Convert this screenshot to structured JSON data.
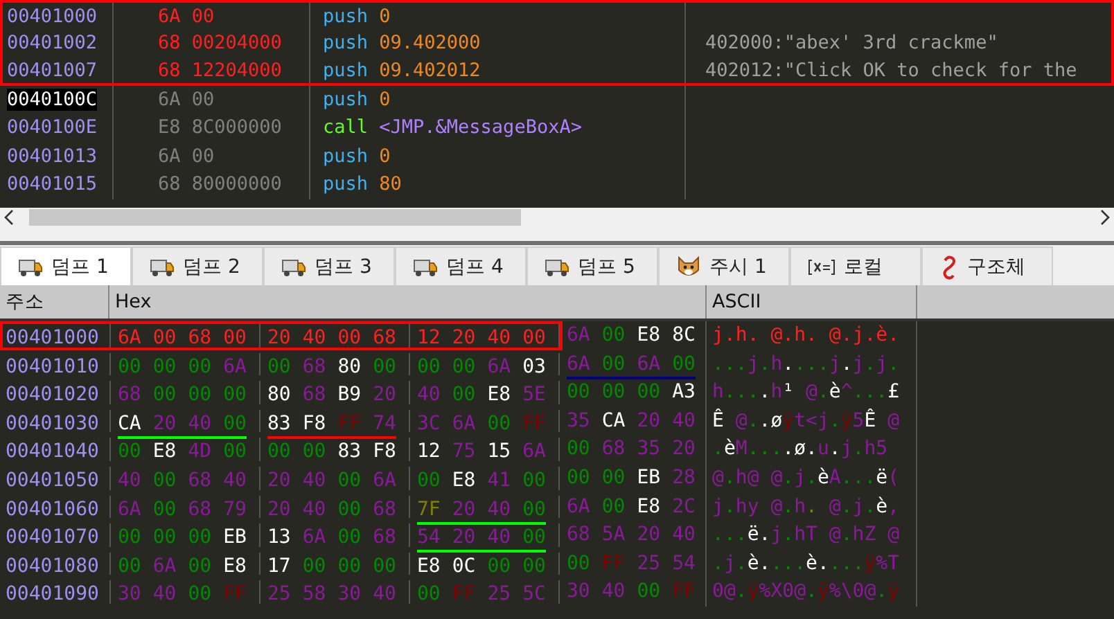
{
  "disassembly": {
    "rows": [
      {
        "address": "00401000",
        "bytes": "6A 00",
        "mnemonic": "push",
        "kind": "push",
        "operand": "0",
        "selected": true,
        "current": false
      },
      {
        "address": "00401002",
        "bytes": "68 00204000",
        "mnemonic": "push",
        "kind": "push",
        "operand": "09.402000",
        "comment": "402000:\"abex' 3rd crackme\"",
        "selected": true,
        "current": false
      },
      {
        "address": "00401007",
        "bytes": "68 12204000",
        "mnemonic": "push",
        "kind": "push",
        "operand": "09.402012",
        "comment": "402012:\"Click OK to check for the",
        "selected": true,
        "current": false
      },
      {
        "address": "0040100C",
        "bytes": "6A 00",
        "mnemonic": "push",
        "kind": "push",
        "operand": "0",
        "selected": false,
        "current": true
      },
      {
        "address": "0040100E",
        "bytes": "E8 8C000000",
        "mnemonic": "call",
        "kind": "call",
        "operand": "<JMP.&MessageBoxA>",
        "selected": false,
        "current": false
      },
      {
        "address": "00401013",
        "bytes": "6A 00",
        "mnemonic": "push",
        "kind": "push",
        "operand": "0",
        "selected": false,
        "current": false
      },
      {
        "address": "00401015",
        "bytes": "68 80000000",
        "mnemonic": "push",
        "kind": "push",
        "operand": "80",
        "selected": false,
        "current": false
      }
    ]
  },
  "tabs": [
    {
      "label": "덤프 1",
      "kind": "dump",
      "selected": true
    },
    {
      "label": "덤프 2",
      "kind": "dump",
      "selected": false
    },
    {
      "label": "덤프 3",
      "kind": "dump",
      "selected": false
    },
    {
      "label": "덤프 4",
      "kind": "dump",
      "selected": false
    },
    {
      "label": "덤프 5",
      "kind": "dump",
      "selected": false
    },
    {
      "label": "주시 1",
      "kind": "watch",
      "selected": false
    },
    {
      "label": "로컬",
      "kind": "locals",
      "selected": false
    },
    {
      "label": "구조체",
      "kind": "struct",
      "selected": false
    }
  ],
  "dump": {
    "columns": [
      "주소",
      "Hex",
      "ASCII"
    ],
    "rows": [
      {
        "address": "00401000",
        "selected": true,
        "groups": [
          {
            "bytes": [
              "6A",
              "00",
              "68",
              "00"
            ]
          },
          {
            "bytes": [
              "20",
              "40",
              "00",
              "68"
            ]
          },
          {
            "bytes": [
              "12",
              "20",
              "40",
              "00"
            ]
          },
          {
            "bytes": [
              "6A",
              "00",
              "E8",
              "8C"
            ]
          }
        ],
        "ascii": "j.h. @.h. @.j.è."
      },
      {
        "address": "00401010",
        "selected": false,
        "groups": [
          {
            "bytes": [
              "00",
              "00",
              "00",
              "6A"
            ]
          },
          {
            "bytes": [
              "00",
              "68",
              "80",
              "00"
            ]
          },
          {
            "bytes": [
              "00",
              "00",
              "6A",
              "03"
            ]
          },
          {
            "bytes": [
              "6A",
              "00",
              "6A",
              "00"
            ],
            "color": "#000080"
          }
        ],
        "ascii": "...j.h....j.j.j."
      },
      {
        "address": "00401020",
        "selected": false,
        "groups": [
          {
            "bytes": [
              "68",
              "00",
              "00",
              "00"
            ]
          },
          {
            "bytes": [
              "80",
              "68",
              "B9",
              "20"
            ]
          },
          {
            "bytes": [
              "40",
              "00",
              "E8",
              "5E"
            ]
          },
          {
            "bytes": [
              "00",
              "00",
              "00",
              "A3"
            ]
          }
        ],
        "ascii": "h....h¹ @.è^...£"
      },
      {
        "address": "00401030",
        "selected": false,
        "groups": [
          {
            "bytes": [
              "CA",
              "20",
              "40",
              "00"
            ],
            "color": "#00ff00"
          },
          {
            "bytes": [
              "83",
              "F8",
              "FF",
              "74"
            ],
            "color": "#ff0000"
          },
          {
            "bytes": [
              "3C",
              "6A",
              "00",
              "FF"
            ]
          },
          {
            "bytes": [
              "35",
              "CA",
              "20",
              "40"
            ]
          }
        ],
        "ascii": "Ê @..øÿt<j.ÿ5Ê @"
      },
      {
        "address": "00401040",
        "selected": false,
        "groups": [
          {
            "bytes": [
              "00",
              "E8",
              "4D",
              "00"
            ]
          },
          {
            "bytes": [
              "00",
              "00",
              "83",
              "F8"
            ]
          },
          {
            "bytes": [
              "12",
              "75",
              "15",
              "6A"
            ]
          },
          {
            "bytes": [
              "00",
              "68",
              "35",
              "20"
            ]
          }
        ],
        "ascii": ".èM....ø.u.j.h5 "
      },
      {
        "address": "00401050",
        "selected": false,
        "groups": [
          {
            "bytes": [
              "40",
              "00",
              "68",
              "40"
            ]
          },
          {
            "bytes": [
              "20",
              "40",
              "00",
              "6A"
            ]
          },
          {
            "bytes": [
              "00",
              "E8",
              "41",
              "00"
            ]
          },
          {
            "bytes": [
              "00",
              "00",
              "EB",
              "28"
            ]
          }
        ],
        "ascii": "@.h@ @.j.èA...ë("
      },
      {
        "address": "00401060",
        "selected": false,
        "groups": [
          {
            "bytes": [
              "6A",
              "00",
              "68",
              "79"
            ]
          },
          {
            "bytes": [
              "20",
              "40",
              "00",
              "68"
            ]
          },
          {
            "bytes": [
              "7F",
              "20",
              "40",
              "00"
            ],
            "color": "#00ff00"
          },
          {
            "bytes": [
              "6A",
              "00",
              "E8",
              "2C"
            ]
          }
        ],
        "ascii": "j.hy @.h. @.j.è,"
      },
      {
        "address": "00401070",
        "selected": false,
        "groups": [
          {
            "bytes": [
              "00",
              "00",
              "00",
              "EB"
            ]
          },
          {
            "bytes": [
              "13",
              "6A",
              "00",
              "68"
            ]
          },
          {
            "bytes": [
              "54",
              "20",
              "40",
              "00"
            ],
            "color": "#00ff00"
          },
          {
            "bytes": [
              "68",
              "5A",
              "20",
              "40"
            ]
          }
        ],
        "ascii": "...ë.j.hT @.hZ @"
      },
      {
        "address": "00401080",
        "selected": false,
        "groups": [
          {
            "bytes": [
              "00",
              "6A",
              "00",
              "E8"
            ]
          },
          {
            "bytes": [
              "17",
              "00",
              "00",
              "00"
            ]
          },
          {
            "bytes": [
              "E8",
              "0C",
              "00",
              "00"
            ]
          },
          {
            "bytes": [
              "00",
              "FF",
              "25",
              "54"
            ]
          }
        ],
        "ascii": ".j.è....è....ÿ%T"
      },
      {
        "address": "00401090",
        "selected": false,
        "groups": [
          {
            "bytes": [
              "30",
              "40",
              "00",
              "FF"
            ]
          },
          {
            "bytes": [
              "25",
              "58",
              "30",
              "40"
            ]
          },
          {
            "bytes": [
              "00",
              "FF",
              "25",
              "5C"
            ]
          },
          {
            "bytes": [
              "30",
              "40",
              "00",
              "FF"
            ]
          }
        ],
        "ascii": "0@.ÿ%X0@.ÿ%\\0@.ÿ"
      }
    ]
  }
}
